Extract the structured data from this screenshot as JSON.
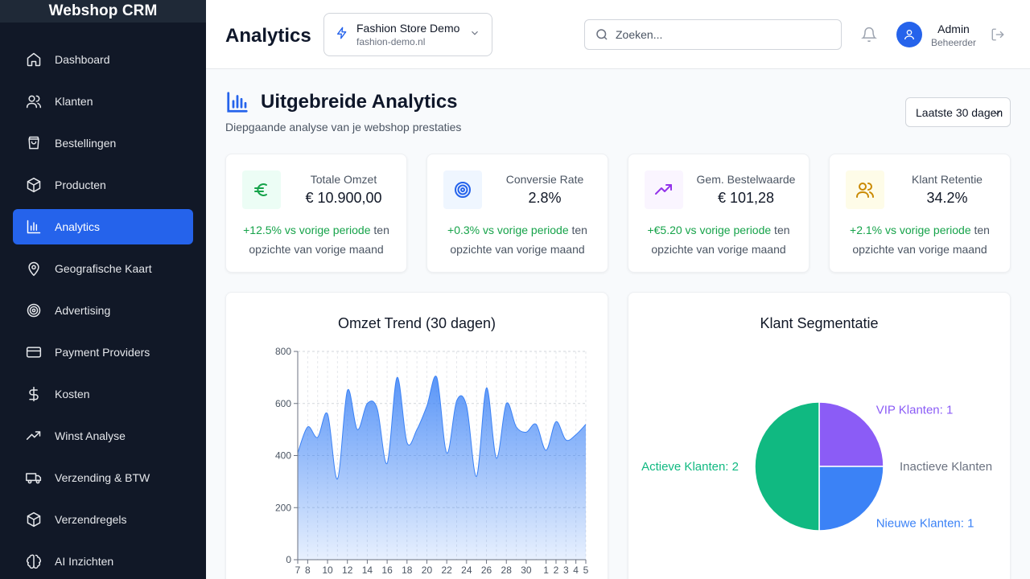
{
  "app": {
    "brand": "Webshop CRM"
  },
  "sidebar": {
    "items": [
      {
        "label": "Dashboard",
        "icon": "home-icon"
      },
      {
        "label": "Klanten",
        "icon": "users-icon"
      },
      {
        "label": "Bestellingen",
        "icon": "shopping-bag-icon"
      },
      {
        "label": "Producten",
        "icon": "package-icon"
      },
      {
        "label": "Analytics",
        "icon": "bar-chart-icon",
        "active": true
      },
      {
        "label": "Geografische Kaart",
        "icon": "map-pin-icon"
      },
      {
        "label": "Advertising",
        "icon": "target-icon"
      },
      {
        "label": "Payment Providers",
        "icon": "credit-card-icon"
      },
      {
        "label": "Kosten",
        "icon": "dollar-icon"
      },
      {
        "label": "Winst Analyse",
        "icon": "trending-up-icon"
      },
      {
        "label": "Verzending & BTW",
        "icon": "truck-icon"
      },
      {
        "label": "Verzendregels",
        "icon": "box-icon"
      },
      {
        "label": "AI Inzichten",
        "icon": "brain-icon"
      }
    ]
  },
  "header": {
    "title": "Analytics",
    "store": {
      "name": "Fashion Store Demo",
      "domain": "fashion-demo.nl"
    },
    "search_placeholder": "Zoeken...",
    "user": {
      "name": "Admin",
      "role": "Beheerder"
    }
  },
  "main": {
    "title": "Uitgebreide Analytics",
    "subtitle": "Diepgaande analyse van je webshop prestaties",
    "range": "Laatste 30 dagen",
    "kpis": [
      {
        "label": "Totale Omzet",
        "value": "€ 10.900,00",
        "change": "+12.5% vs vorige periode",
        "suffix": " ten opzichte van vorige maand",
        "icon": "euro-icon",
        "color": "#16a34a",
        "bg": "#ecfdf5"
      },
      {
        "label": "Conversie Rate",
        "value": "2.8%",
        "change": "+0.3% vs vorige periode",
        "suffix": " ten opzichte van vorige maand",
        "icon": "target-icon",
        "color": "#2563eb",
        "bg": "#eff6ff"
      },
      {
        "label": "Gem. Bestelwaarde",
        "value": "€ 101,28",
        "change": "+€5.20 vs vorige periode",
        "suffix": " ten opzichte van vorige maand",
        "icon": "trending-up-icon",
        "color": "#9333ea",
        "bg": "#faf5ff"
      },
      {
        "label": "Klant Retentie",
        "value": "34.2%",
        "change": "+2.1% vs vorige periode",
        "suffix": " ten opzichte van vorige maand",
        "icon": "users-icon",
        "color": "#ca8a04",
        "bg": "#fefce8"
      }
    ]
  },
  "chart_data": [
    {
      "type": "area",
      "title": "Omzet Trend (30 dagen)",
      "x": [
        "7",
        "8",
        "9",
        "10",
        "11",
        "12",
        "13",
        "14",
        "15",
        "16",
        "17",
        "18",
        "19",
        "20",
        "21",
        "22",
        "23",
        "24",
        "25",
        "26",
        "27",
        "28",
        "29",
        "30",
        "31",
        "1",
        "2",
        "3",
        "4",
        "5"
      ],
      "tick_labels": [
        "7",
        "8",
        "10",
        "12",
        "14",
        "16",
        "18",
        "20",
        "22",
        "24",
        "26",
        "28",
        "30",
        "1",
        "2",
        "3",
        "4",
        "5"
      ],
      "values": [
        410,
        510,
        470,
        560,
        310,
        650,
        500,
        600,
        580,
        370,
        700,
        450,
        500,
        590,
        700,
        410,
        610,
        590,
        320,
        660,
        390,
        600,
        510,
        490,
        520,
        420,
        530,
        460,
        480,
        520
      ],
      "ylim": [
        0,
        800
      ],
      "yticks": [
        0,
        200,
        400,
        600,
        800
      ],
      "color": "#3b82f6",
      "grid": true
    },
    {
      "type": "pie",
      "title": "Klant Segmentatie",
      "slices": [
        {
          "label": "VIP Klanten: 1",
          "value": 1,
          "color": "#8b5cf6"
        },
        {
          "label": "Inactieve Klanten",
          "value": 0,
          "color": "#6b7280"
        },
        {
          "label": "Nieuwe Klanten: 1",
          "value": 1,
          "color": "#3b82f6"
        },
        {
          "label": "Actieve Klanten: 2",
          "value": 2,
          "color": "#10b981"
        }
      ]
    }
  ]
}
